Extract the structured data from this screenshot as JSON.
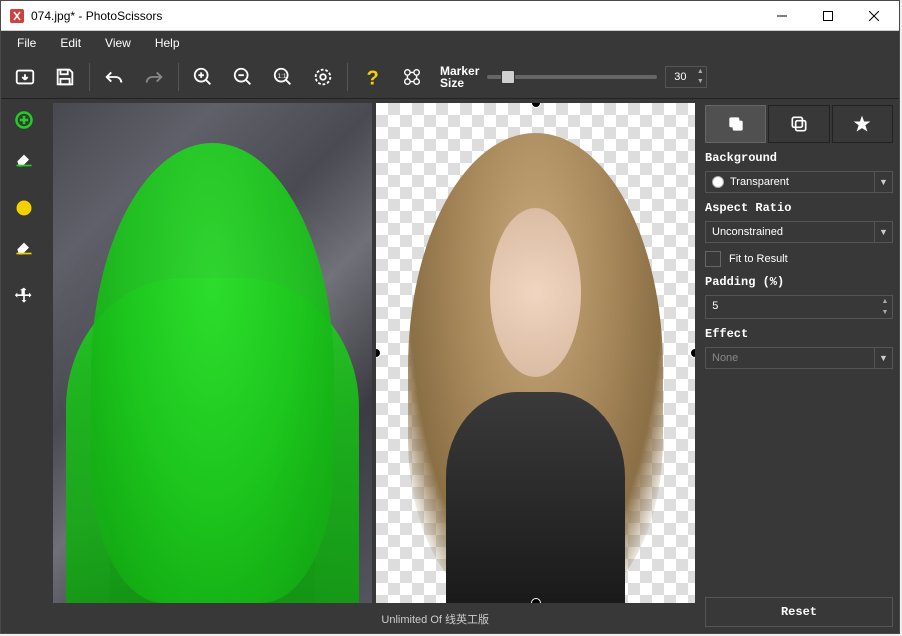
{
  "window": {
    "title": "074.jpg* - PhotoScissors"
  },
  "menu": {
    "file": "File",
    "edit": "Edit",
    "view": "View",
    "help": "Help"
  },
  "toolbar": {
    "marker_label_line1": "Marker",
    "marker_label_line2": "Size",
    "marker_value": "30"
  },
  "panel": {
    "background_label": "Background",
    "background_value": "Transparent",
    "aspect_label": "Aspect Ratio",
    "aspect_value": "Unconstrained",
    "fit_label": "Fit to Result",
    "padding_label": "Padding (%)",
    "padding_value": "5",
    "effect_label": "Effect",
    "effect_value": "None",
    "reset": "Reset"
  },
  "status": {
    "text": "Unlimited Of 线英工版"
  }
}
